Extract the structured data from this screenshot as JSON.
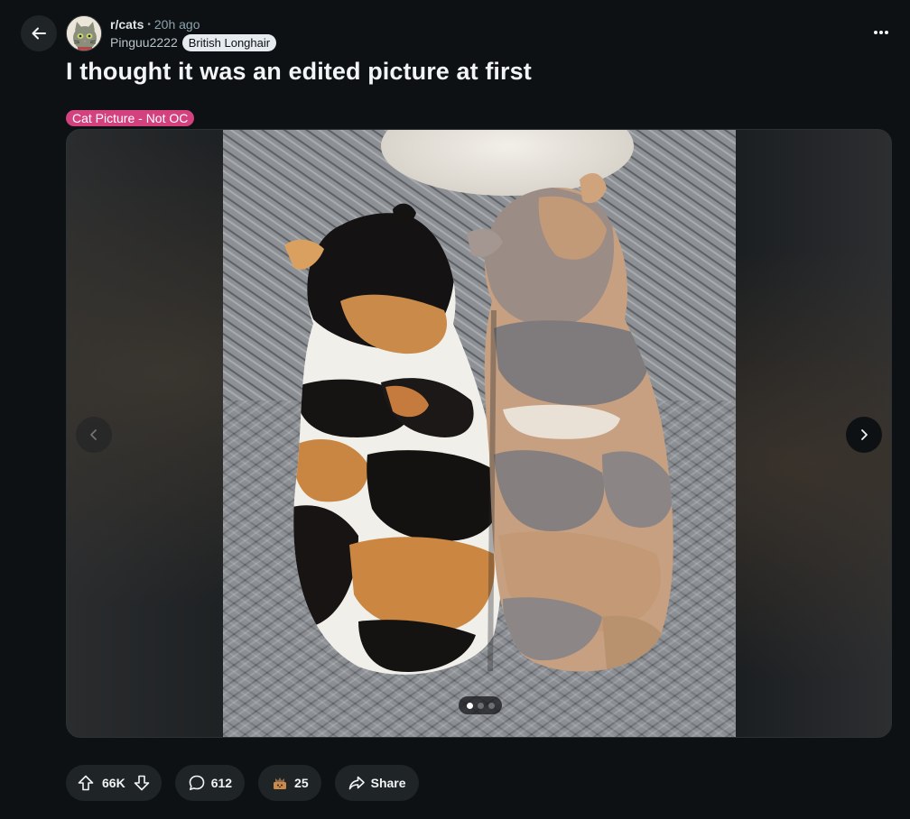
{
  "post": {
    "subreddit": "r/cats",
    "separator": "•",
    "time_ago": "20h ago",
    "username": "Pinguu2222",
    "user_flair": "British Longhair",
    "title": "I thought it was an edited picture at first",
    "post_flair": "Cat Picture - Not OC",
    "flair_color": "#d4417f"
  },
  "gallery": {
    "image_description": "two cats photographed from above, sitting side by side on a gray blanket — a calico and a dilute calico",
    "image_count": 3,
    "current_index": 1
  },
  "actions": {
    "votes": "66K",
    "comments": "612",
    "awards": "25",
    "share_label": "Share"
  },
  "icons": {
    "back": "arrow-left-icon",
    "more": "more-horizontal-icon",
    "prev": "chevron-left-icon",
    "next": "chevron-right-icon",
    "upvote": "upvote-arrow-icon",
    "downvote": "downvote-arrow-icon",
    "comment": "comment-bubble-icon",
    "award": "award-icon",
    "share": "share-arrow-icon"
  },
  "colors": {
    "background": "#0e1113",
    "pill": "#1f2526",
    "text": "#f2f4f5",
    "muted": "#8ba2ad"
  }
}
